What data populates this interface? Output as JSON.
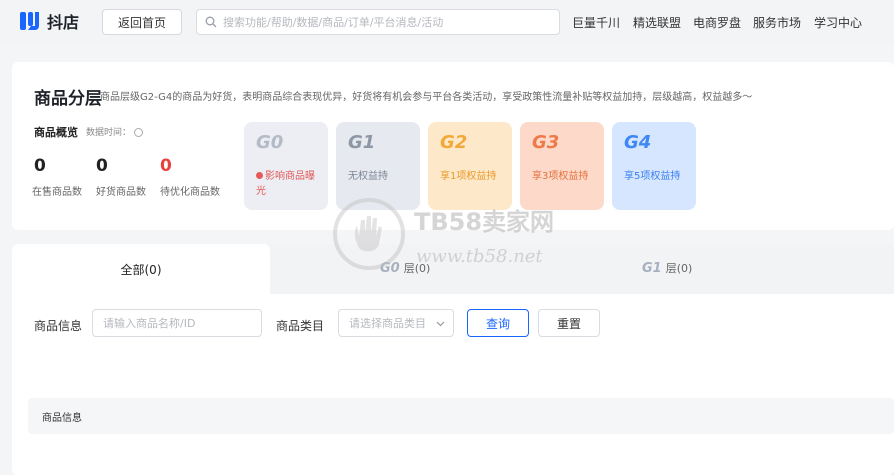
{
  "header": {
    "logo_text": "抖店",
    "back_label": "返回首页",
    "search_placeholder": "搜索功能/帮助/数据/商品/订单/平台消息/活动",
    "nav": [
      "巨量千川",
      "精选联盟",
      "电商罗盘",
      "服务市场",
      "学习中心"
    ]
  },
  "overview": {
    "title": "商品分层",
    "description": "商品层级G2-G4的商品为好货，表明商品综合表现优异，好货将有机会参与平台各类活动，享受政策性流量补贴等权益加持，层级越高，权益越多～",
    "section_label": "商品概览",
    "data_time": "数据时间：",
    "stats": [
      {
        "value": "0",
        "label": "在售商品数",
        "color": "#222222"
      },
      {
        "value": "0",
        "label": "好货商品数",
        "color": "#222222"
      },
      {
        "value": "0",
        "label": "待优化商品数",
        "color": "#e8413e"
      }
    ]
  },
  "grades": [
    {
      "name": "G0",
      "desc": "影响商品曝光",
      "bg": "#eceef3",
      "name_color": "#b4bac6",
      "desc_color": "#e25a59"
    },
    {
      "name": "G1",
      "desc": "无权益持",
      "bg": "#e6e9ef",
      "name_color": "#8e97a6",
      "desc_color": "#7d8694"
    },
    {
      "name": "G2",
      "desc": "享1项权益持",
      "bg": "#fde9c9",
      "name_color": "#f3a93a",
      "desc_color": "#e99a28"
    },
    {
      "name": "G3",
      "desc": "享3项权益持",
      "bg": "#fcd9c8",
      "name_color": "#ee7a4c",
      "desc_color": "#e6703f"
    },
    {
      "name": "G4",
      "desc": "享5项权益持",
      "bg": "#d6e6ff",
      "name_color": "#3f86f6",
      "desc_color": "#3a7ff0"
    }
  ],
  "tabs": {
    "all": "全部(0)",
    "g0_badge": "G0",
    "g0_label": "层(0)",
    "g1_badge": "G1",
    "g1_label": "层(0)"
  },
  "filters": {
    "product_info_label": "商品信息",
    "product_info_placeholder": "请输入商品名称/ID",
    "category_label": "商品类目",
    "category_placeholder": "请选择商品类目",
    "query_label": "查询",
    "reset_label": "重置"
  },
  "table": {
    "header": "商品信息"
  },
  "watermark": {
    "brand": "TB58卖家网",
    "url": "www.tb58.net"
  },
  "accent": "#1966ff"
}
